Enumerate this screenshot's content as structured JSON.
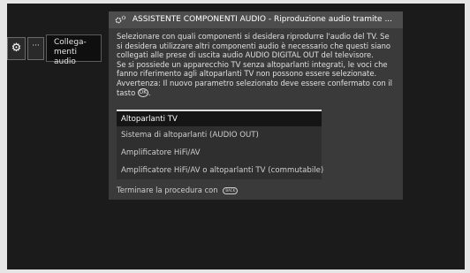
{
  "nav": {
    "gear_symbol": "⚙",
    "more_label": "···",
    "item_label": "Collega-\nmenti audio"
  },
  "dialog": {
    "title": "ASSISTENTE COMPONENTI AUDIO - Riproduzione audio tramite ...",
    "description_lines": [
      "Selezionare con quali componenti si desidera riprodurre l'audio del TV. Se",
      "si desidera utilizzare altri componenti audio è necessario che questi siano",
      "collegati alle prese di uscita audio AUDIO DIGITAL OUT del televisore.",
      "Se si possiede un apparecchio TV senza altoparlanti integrati, le voci che",
      "fanno riferimento agli altoparlanti TV non possono essere selezionate.",
      "Avvertenza: Il nuovo parametro selezionato deve essere confermato con il",
      "tasto"
    ],
    "ok_key_label": "OK",
    "options": [
      "Altoparlanti TV",
      "Sistema di altoparlanti (AUDIO OUT)",
      "Amplificatore HiFi/AV",
      "Amplificatore HiFi/AV o altoparlanti TV (commutabile)"
    ],
    "selected_index": 0,
    "footer_text": "Terminare la procedura con",
    "back_key_label": "BACK"
  }
}
